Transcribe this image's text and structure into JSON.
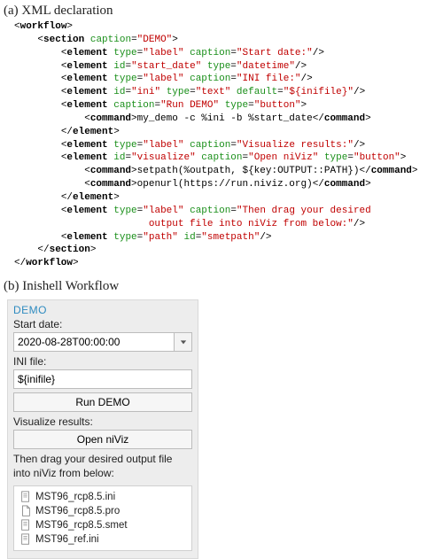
{
  "figure": {
    "label_a": "(a) XML declaration",
    "label_b": "(b) Inishell Workflow"
  },
  "xml": {
    "t_workflow": "workflow",
    "t_section": "section",
    "t_element": "element",
    "t_command": "command",
    "a_caption": "caption",
    "a_type": "type",
    "a_id": "id",
    "a_default": "default",
    "v_demo": "\"DEMO\"",
    "v_label": "\"label\"",
    "v_startdate_cap": "\"Start date:\"",
    "v_startdate_id": "\"start_date\"",
    "v_datetime": "\"datetime\"",
    "v_inifile_cap": "\"INI file:\"",
    "v_ini_id": "\"ini\"",
    "v_text": "\"text\"",
    "v_inifile_def": "\"${inifile}\"",
    "v_rundemo": "\"Run DEMO\"",
    "v_button": "\"button\"",
    "cmd_rundemo": "my_demo -c %ini -b %start_date",
    "v_visres": "\"Visualize results:\"",
    "v_visualize_id": "\"visualize\"",
    "v_openniviz": "\"Open niViz\"",
    "cmd_setpath": "setpath(%outpath, ${key:OUTPUT::PATH})",
    "cmd_openurl": "openurl(https://run.niviz.org)",
    "v_thendrag1": "\"Then drag your desired",
    "v_thendrag2": "output file into niViz from below:\"",
    "v_path": "\"path\"",
    "v_smetpath": "\"smetpath\""
  },
  "panel": {
    "title": "DEMO",
    "startdate_label": "Start date:",
    "startdate_value": "2020-08-28T00:00:00",
    "inifile_label": "INI file:",
    "inifile_value": "${inifile}",
    "run_button": "Run DEMO",
    "visualize_label": "Visualize results:",
    "openniviz_button": "Open niViz",
    "drag_label": "Then drag your desired output file into niViz from below:",
    "files": {
      "f0": "MST96_rcp8.5.ini",
      "f1": "MST96_rcp8.5.pro",
      "f2": "MST96_rcp8.5.smet",
      "f3": "MST96_ref.ini"
    }
  }
}
